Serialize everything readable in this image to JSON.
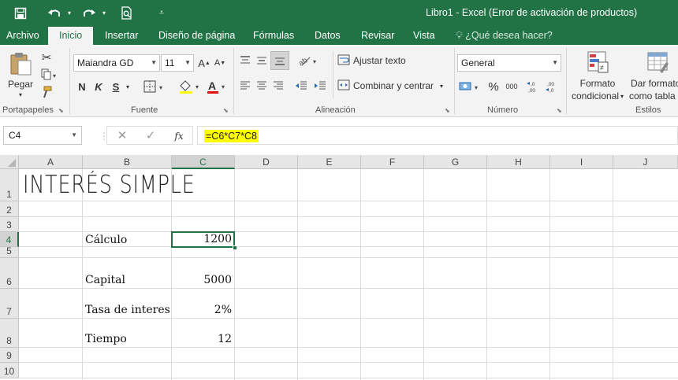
{
  "titlebar": {
    "title": "Libro1 - Excel (Error de activación de productos)",
    "save_icon": "save-icon",
    "undo_icon": "undo-icon",
    "redo_icon": "redo-icon",
    "preview_icon": "print-preview-icon",
    "customize_icon": "customize-qat-icon"
  },
  "menu": {
    "tabs": [
      "Archivo",
      "Inicio",
      "Insertar",
      "Diseño de página",
      "Fórmulas",
      "Datos",
      "Revisar",
      "Vista"
    ],
    "active": "Inicio",
    "tell_me": "¿Qué desea hacer?"
  },
  "ribbon": {
    "clipboard": {
      "paste_label": "Pegar",
      "group_label": "Portapapeles"
    },
    "font": {
      "font_name": "Maiandra GD",
      "font_size": "11",
      "bold": "N",
      "italic": "K",
      "underline": "S",
      "group_label": "Fuente",
      "font_color": "#e01010"
    },
    "alignment": {
      "wrap_text": "Ajustar texto",
      "merge_center": "Combinar y centrar",
      "group_label": "Alineación"
    },
    "number": {
      "format": "General",
      "percent": "%",
      "thousands": "000",
      "group_label": "Número"
    },
    "styles": {
      "conditional_line1": "Formato",
      "conditional_line2": "condicional",
      "table_line1": "Dar formato",
      "table_line2": "como tabla",
      "group_label": "Estilos"
    }
  },
  "formula_bar": {
    "name_box": "C4",
    "cancel_symbol": "✕",
    "enter_symbol": "✓",
    "fx_symbol": "fx",
    "formula": "=C6*C7*C8",
    "highlight_color": "#ffff00"
  },
  "sheet": {
    "columns": [
      "A",
      "B",
      "C",
      "D",
      "E",
      "F",
      "G",
      "H",
      "I",
      "J"
    ],
    "rows": [
      "1",
      "2",
      "3",
      "4",
      "5",
      "6",
      "7",
      "8",
      "9",
      "10"
    ],
    "selected_cell": "C4",
    "title": "INTERÉS SIMPLE",
    "labels": {
      "calculo": "Cálculo",
      "capital": "Capital",
      "tasa": "Tasa de interes",
      "tiempo": "Tiempo"
    },
    "values": {
      "calculo": "1200",
      "capital": "5000",
      "tasa": "2%",
      "tiempo": "12"
    },
    "accent_color": "#217346"
  }
}
